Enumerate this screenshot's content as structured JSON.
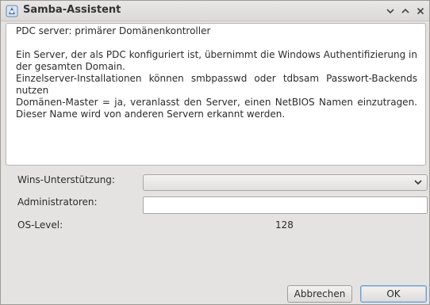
{
  "window": {
    "title": "Samba-Assistent",
    "icons": {
      "app": "samba-app-icon",
      "minimize": "chevron-down-icon",
      "maximize": "chevron-up-icon",
      "close": "close-icon"
    }
  },
  "description": {
    "lines": [
      "PDC server: primärer Domänenkontroller",
      "",
      "Ein Server, der als PDC konfiguriert ist, übernimmt die Windows Authentifizierung in der gesamten Domain.",
      "Einzelserver-Installationen können smbpasswd oder tdbsam Passwort-Backends nutzen",
      "Domänen-Master = ja, veranlasst den Server, einen NetBIOS Namen einzutragen. Dieser Name wird von anderen Servern erkannt werden."
    ]
  },
  "form": {
    "wins_label": "Wins-Unterstützung:",
    "wins_value": "",
    "admins_label": "Administratoren:",
    "admins_value": "",
    "oslevel_label": "OS-Level:",
    "oslevel_value": "128"
  },
  "buttons": {
    "cancel": "Abbrechen",
    "ok": "OK"
  },
  "colors": {
    "window_bg": "#e4e3e1",
    "ok_border": "#6f9fd3"
  }
}
